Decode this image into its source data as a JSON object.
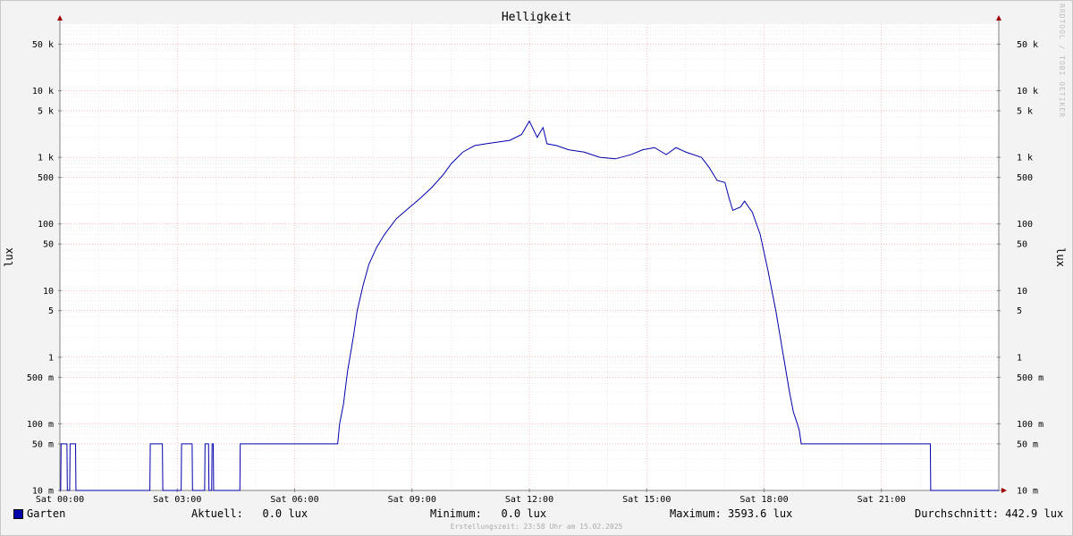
{
  "chart_data": {
    "type": "line",
    "title": "Helligkeit",
    "ylabel": "lux",
    "y_scale": "log",
    "ylim": [
      0.01,
      100000
    ],
    "xlim": [
      "Sat 00:00",
      "Sat 24:00"
    ],
    "grid": true,
    "x_ticks": [
      "Sat 00:00",
      "Sat 03:00",
      "Sat 06:00",
      "Sat 09:00",
      "Sat 12:00",
      "Sat 15:00",
      "Sat 18:00",
      "Sat 21:00"
    ],
    "y_ticks": [
      {
        "value": 0.01,
        "label": "10 m"
      },
      {
        "value": 0.05,
        "label": "50 m"
      },
      {
        "value": 0.1,
        "label": "100 m"
      },
      {
        "value": 0.5,
        "label": "500 m"
      },
      {
        "value": 1,
        "label": "1"
      },
      {
        "value": 5,
        "label": "5"
      },
      {
        "value": 10,
        "label": "10"
      },
      {
        "value": 50,
        "label": "50"
      },
      {
        "value": 100,
        "label": "100"
      },
      {
        "value": 500,
        "label": "500"
      },
      {
        "value": 1000,
        "label": "1 k"
      },
      {
        "value": 5000,
        "label": "5 k"
      },
      {
        "value": 10000,
        "label": "10 k"
      },
      {
        "value": 50000,
        "label": "50 k"
      }
    ],
    "series": [
      {
        "name": "Garten",
        "color": "#0000aa",
        "points": [
          [
            0.0,
            0.01
          ],
          [
            0.02,
            0.01
          ],
          [
            0.03,
            0.05
          ],
          [
            0.18,
            0.05
          ],
          [
            0.19,
            0.01
          ],
          [
            0.25,
            0.01
          ],
          [
            0.26,
            0.05
          ],
          [
            0.4,
            0.05
          ],
          [
            0.41,
            0.01
          ],
          [
            2.3,
            0.01
          ],
          [
            2.31,
            0.05
          ],
          [
            2.62,
            0.05
          ],
          [
            2.63,
            0.01
          ],
          [
            3.1,
            0.01
          ],
          [
            3.11,
            0.05
          ],
          [
            3.38,
            0.05
          ],
          [
            3.39,
            0.01
          ],
          [
            3.7,
            0.01
          ],
          [
            3.71,
            0.05
          ],
          [
            3.8,
            0.05
          ],
          [
            3.81,
            0.01
          ],
          [
            3.88,
            0.01
          ],
          [
            3.89,
            0.05
          ],
          [
            3.92,
            0.05
          ],
          [
            3.93,
            0.01
          ],
          [
            4.6,
            0.01
          ],
          [
            4.61,
            0.05
          ],
          [
            7.1,
            0.05
          ],
          [
            7.15,
            0.1
          ],
          [
            7.25,
            0.2
          ],
          [
            7.35,
            0.6
          ],
          [
            7.5,
            2
          ],
          [
            7.6,
            5
          ],
          [
            7.75,
            12
          ],
          [
            7.9,
            25
          ],
          [
            8.1,
            45
          ],
          [
            8.3,
            70
          ],
          [
            8.6,
            120
          ],
          [
            8.9,
            170
          ],
          [
            9.2,
            240
          ],
          [
            9.5,
            350
          ],
          [
            9.8,
            550
          ],
          [
            10.0,
            800
          ],
          [
            10.3,
            1200
          ],
          [
            10.6,
            1500
          ],
          [
            10.9,
            1600
          ],
          [
            11.2,
            1700
          ],
          [
            11.5,
            1800
          ],
          [
            11.8,
            2200
          ],
          [
            12.0,
            3500
          ],
          [
            12.2,
            2000
          ],
          [
            12.35,
            2800
          ],
          [
            12.45,
            1600
          ],
          [
            12.7,
            1500
          ],
          [
            13.0,
            1300
          ],
          [
            13.4,
            1200
          ],
          [
            13.8,
            1000
          ],
          [
            14.2,
            950
          ],
          [
            14.6,
            1100
          ],
          [
            14.9,
            1300
          ],
          [
            15.2,
            1400
          ],
          [
            15.5,
            1100
          ],
          [
            15.75,
            1400
          ],
          [
            16.0,
            1200
          ],
          [
            16.4,
            1000
          ],
          [
            16.6,
            700
          ],
          [
            16.8,
            450
          ],
          [
            17.0,
            420
          ],
          [
            17.1,
            250
          ],
          [
            17.2,
            160
          ],
          [
            17.4,
            180
          ],
          [
            17.5,
            220
          ],
          [
            17.7,
            150
          ],
          [
            17.9,
            70
          ],
          [
            18.1,
            20
          ],
          [
            18.3,
            5
          ],
          [
            18.5,
            1
          ],
          [
            18.65,
            0.3
          ],
          [
            18.75,
            0.15
          ],
          [
            18.85,
            0.1
          ],
          [
            18.9,
            0.08
          ],
          [
            18.95,
            0.05
          ],
          [
            22.25,
            0.05
          ],
          [
            22.26,
            0.01
          ],
          [
            24.0,
            0.01
          ]
        ]
      }
    ]
  },
  "legend": {
    "series_name": "Garten",
    "aktuell": "Aktuell:   0.0 lux",
    "minimum": "Minimum:   0.0 lux",
    "maximum": "Maximum: 3593.6 lux",
    "durchschnitt": "Durchschnitt: 442.9 lux"
  },
  "footer": "Erstellungszeit: 23:58 Uhr am 15.02.2025",
  "watermark": "RRDTOOL / TOBI OETIKER"
}
